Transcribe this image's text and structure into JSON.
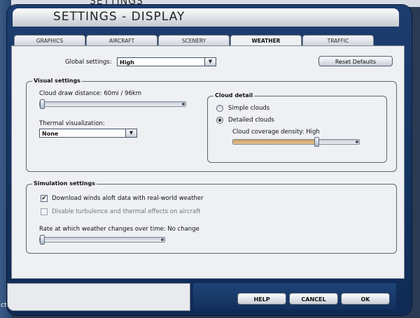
{
  "background": {
    "ghost_title": "SETTINGS",
    "left_text": "cts"
  },
  "window": {
    "title": "SETTINGS - DISPLAY"
  },
  "tabs": [
    {
      "label": "GRAPHICS",
      "active": false
    },
    {
      "label": "AIRCRAFT",
      "active": false
    },
    {
      "label": "SCENERY",
      "active": false
    },
    {
      "label": "WEATHER",
      "active": true
    },
    {
      "label": "TRAFFIC",
      "active": false
    }
  ],
  "global": {
    "label": "Global settings:",
    "value": "High"
  },
  "reset_button": "Reset Defaults",
  "visual": {
    "title": "Visual settings",
    "cloud_distance_label": "Cloud draw distance: 60mi / 96km",
    "cloud_distance_level": 0.0,
    "thermal_label": "Thermal visualization:",
    "thermal_value": "None",
    "cloud_detail": {
      "title": "Cloud detail",
      "simple_label": "Simple clouds",
      "detailed_label": "Detailed clouds",
      "selected": "Detailed clouds",
      "coverage_label": "Cloud coverage density: High",
      "coverage_level": 0.66
    }
  },
  "simulation": {
    "title": "Simulation settings",
    "download_winds_label": "Download winds aloft data with real-world weather",
    "download_winds_checked": true,
    "disable_turbulence_label": "Disable turbulence and thermal effects on aircraft",
    "disable_turbulence_checked": false,
    "rate_label": "Rate at which weather changes over time: No change",
    "rate_level": 0.0
  },
  "buttons": {
    "help": "HELP",
    "cancel": "CANCEL",
    "ok": "OK"
  },
  "colors": {
    "frame": "#1c3d6e",
    "panel": "#eef0f3",
    "slider_fill": "#c9a062"
  }
}
